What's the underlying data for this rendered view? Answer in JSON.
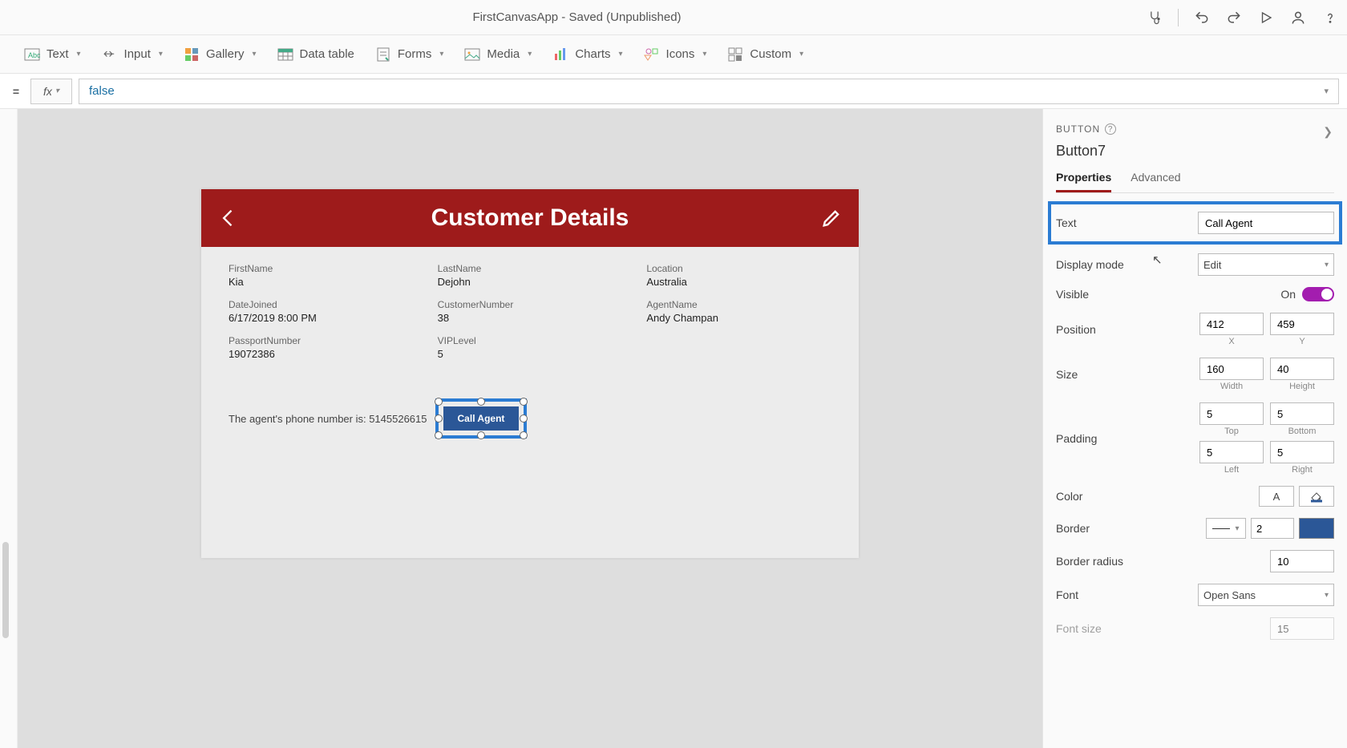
{
  "appTitle": "FirstCanvasApp - Saved (Unpublished)",
  "ribbon": {
    "text": "Text",
    "input": "Input",
    "gallery": "Gallery",
    "dataTable": "Data table",
    "forms": "Forms",
    "media": "Media",
    "charts": "Charts",
    "icons": "Icons",
    "custom": "Custom"
  },
  "formula": {
    "value": "false"
  },
  "screen": {
    "title": "Customer Details",
    "fields": {
      "firstName": {
        "label": "FirstName",
        "value": "Kia"
      },
      "lastName": {
        "label": "LastName",
        "value": "Dejohn"
      },
      "location": {
        "label": "Location",
        "value": "Australia"
      },
      "dateJoined": {
        "label": "DateJoined",
        "value": "6/17/2019 8:00 PM"
      },
      "customerNumber": {
        "label": "CustomerNumber",
        "value": "38"
      },
      "agentName": {
        "label": "AgentName",
        "value": "Andy Champan"
      },
      "passportNumber": {
        "label": "PassportNumber",
        "value": "19072386"
      },
      "vipLevel": {
        "label": "VIPLevel",
        "value": "5"
      }
    },
    "agentPhoneLabel": "The agent's phone number is:  5145526615",
    "callAgentBtn": "Call Agent"
  },
  "props": {
    "typeLabel": "BUTTON",
    "elementName": "Button7",
    "tabs": {
      "properties": "Properties",
      "advanced": "Advanced"
    },
    "text": {
      "label": "Text",
      "value": "Call Agent"
    },
    "displayMode": {
      "label": "Display mode",
      "value": "Edit"
    },
    "visible": {
      "label": "Visible",
      "value": "On"
    },
    "position": {
      "label": "Position",
      "x": "412",
      "y": "459",
      "xLabel": "X",
      "yLabel": "Y"
    },
    "size": {
      "label": "Size",
      "w": "160",
      "h": "40",
      "wLabel": "Width",
      "hLabel": "Height"
    },
    "padding": {
      "label": "Padding",
      "top": "5",
      "bottom": "5",
      "left": "5",
      "right": "5",
      "topLabel": "Top",
      "bottomLabel": "Bottom",
      "leftLabel": "Left",
      "rightLabel": "Right"
    },
    "color": {
      "label": "Color",
      "glyph": "A"
    },
    "border": {
      "label": "Border",
      "width": "2"
    },
    "borderRadius": {
      "label": "Border radius",
      "value": "10"
    },
    "font": {
      "label": "Font",
      "value": "Open Sans"
    },
    "fontSize": {
      "label": "Font size",
      "value": "15"
    }
  }
}
